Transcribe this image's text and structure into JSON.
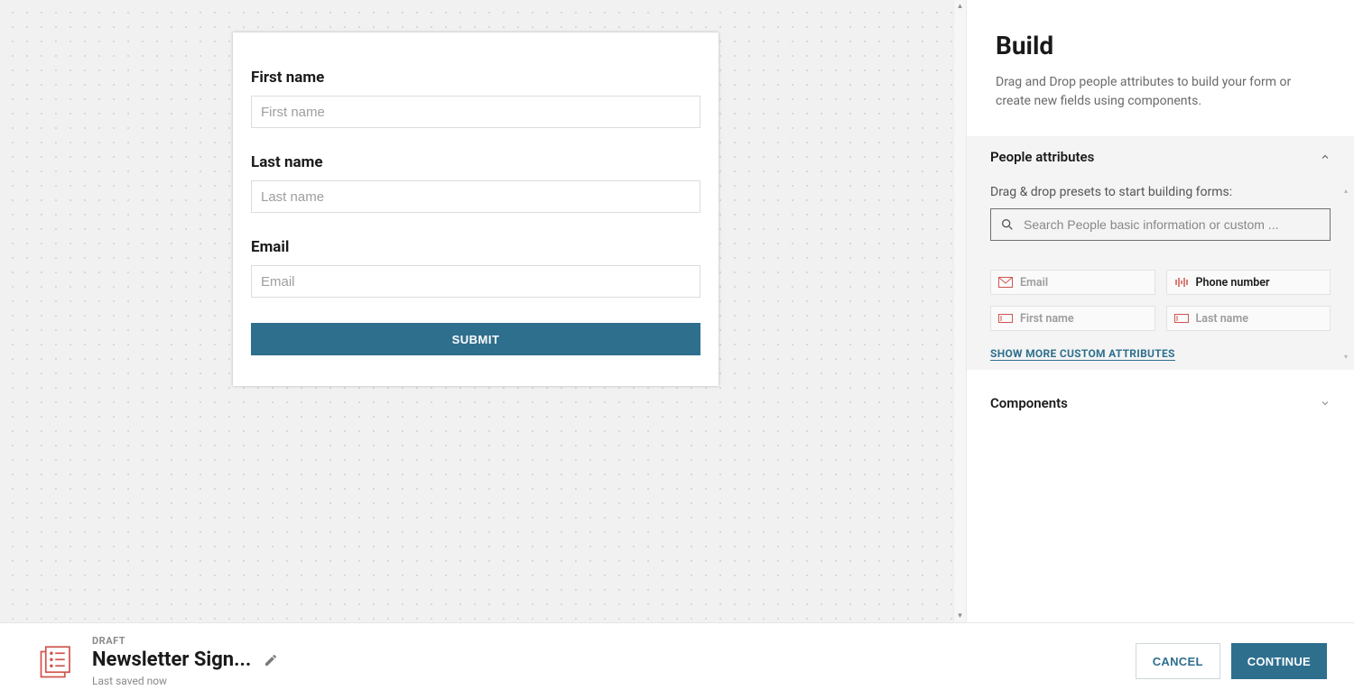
{
  "canvas": {
    "fields": [
      {
        "label": "First name",
        "placeholder": "First name"
      },
      {
        "label": "Last name",
        "placeholder": "Last name"
      },
      {
        "label": "Email",
        "placeholder": "Email"
      }
    ],
    "submit_label": "SUBMIT"
  },
  "sidebar": {
    "title": "Build",
    "subtitle": "Drag and Drop people attributes to build your form or create new fields using components.",
    "sections": {
      "people_attributes_label": "People attributes",
      "components_label": "Components"
    },
    "attributes_panel": {
      "hint": "Drag & drop presets to start building forms:",
      "search_placeholder": "Search People basic information or custom ...",
      "presets": [
        {
          "label": "Email",
          "used": true
        },
        {
          "label": "Phone number",
          "used": false
        },
        {
          "label": "First name",
          "used": true
        },
        {
          "label": "Last name",
          "used": true
        }
      ],
      "show_more_label": "SHOW MORE CUSTOM ATTRIBUTES"
    }
  },
  "footer": {
    "badge": "DRAFT",
    "title": "Newsletter Sign...",
    "saved": "Last saved now",
    "cancel_label": "CANCEL",
    "continue_label": "CONTINUE"
  },
  "colors": {
    "accent": "#2f6f8e",
    "brand_red": "#d0564e"
  }
}
